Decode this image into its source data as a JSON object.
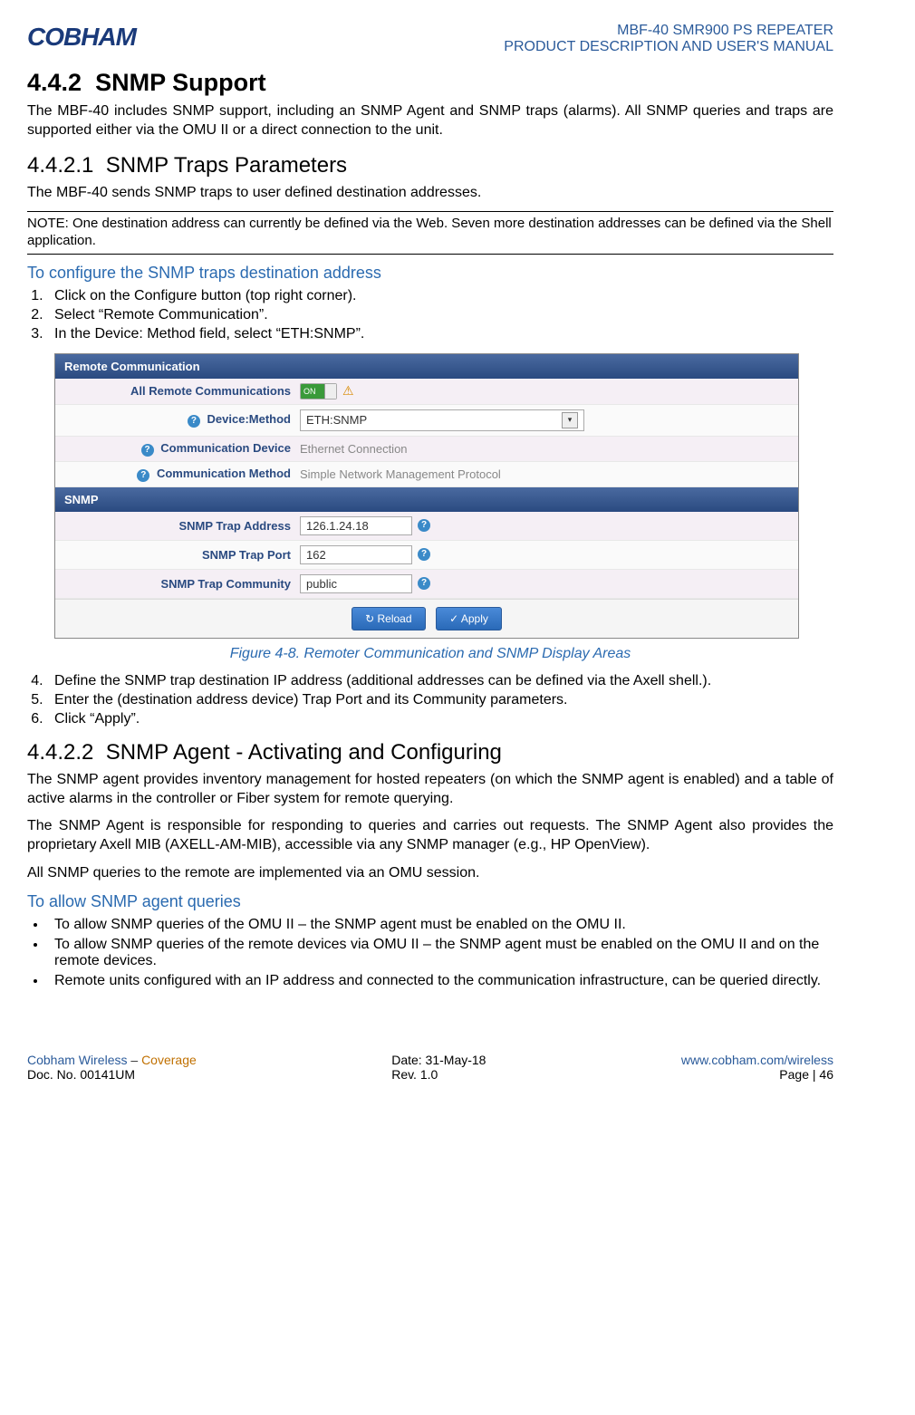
{
  "header": {
    "logo_text": "COBHAM",
    "title_line1": "MBF-40 SMR900 PS REPEATER",
    "title_line2": "PRODUCT DESCRIPTION AND USER'S MANUAL"
  },
  "s442": {
    "number": "4.4.2",
    "title": "SNMP Support",
    "para": "The MBF-40 includes SNMP support, including an SNMP Agent and SNMP traps (alarms). All SNMP queries and traps are supported either via the OMU II or a direct connection to the unit."
  },
  "s4421": {
    "number": "4.4.2.1",
    "title": "SNMP Traps Parameters",
    "para": "The MBF-40 sends SNMP traps to user defined destination addresses.",
    "note": "NOTE: One destination address can currently be defined via the Web. Seven more destination addresses can be defined via the Shell application.",
    "blue_sub": "To configure the SNMP traps destination address",
    "steps_a": [
      "Click on the Configure button (top right corner).",
      "Select “Remote Communication”.",
      "In the Device: Method field, select “ETH:SNMP”."
    ],
    "figure_caption": "Figure 4-8. Remoter Communication and SNMP Display Areas",
    "steps_b": [
      "Define the SNMP trap destination IP address (additional addresses can be defined via the Axell shell.).",
      "Enter the (destination address device) Trap Port and its Community parameters.",
      "Click “Apply”."
    ]
  },
  "screenshot": {
    "panel1_title": "Remote Communication",
    "rows1": [
      {
        "label": "All Remote Communications",
        "type": "toggle",
        "value": "ON"
      },
      {
        "label": "Device:Method",
        "type": "select",
        "value": "ETH:SNMP",
        "help": true
      },
      {
        "label": "Communication Device",
        "type": "text_ro",
        "value": "Ethernet Connection",
        "help": true
      },
      {
        "label": "Communication Method",
        "type": "text_ro",
        "value": "Simple Network Management Protocol",
        "help": true
      }
    ],
    "panel2_title": "SNMP",
    "rows2": [
      {
        "label": "SNMP Trap Address",
        "type": "input",
        "value": "126.1.24.18"
      },
      {
        "label": "SNMP Trap Port",
        "type": "input",
        "value": "162"
      },
      {
        "label": "SNMP Trap Community",
        "type": "input",
        "value": "public"
      }
    ],
    "btn_reload": "Reload",
    "btn_apply": "Apply"
  },
  "s4422": {
    "number": "4.4.2.2",
    "title": "SNMP Agent - Activating and Configuring",
    "para1": "The SNMP agent provides inventory management for hosted repeaters (on which the SNMP agent is enabled) and a table of active alarms in the controller or Fiber system for remote querying.",
    "para2": "The SNMP Agent is responsible for responding to queries and carries out requests. The SNMP Agent also provides the proprietary Axell MIB (AXELL-AM-MIB), accessible via any SNMP manager (e.g., HP OpenView).",
    "para3": "All SNMP queries to the remote are implemented via an OMU session.",
    "blue_sub": "To allow SNMP agent queries",
    "bullets": [
      "To allow SNMP queries of the OMU II – the SNMP agent must be enabled on the OMU II.",
      "To allow SNMP queries of the remote devices via OMU II – the SNMP agent must be enabled on the OMU II and on the remote devices.",
      "Remote units configured with an IP address and connected to the communication infrastructure, can be queried directly."
    ]
  },
  "footer": {
    "col1_l1_a": "Cobham Wireless",
    "col1_l1_dash": " – ",
    "col1_l1_b": "Coverage",
    "col1_l2": "Doc. No. 00141UM",
    "col2_l1": "Date: 31-May-18",
    "col2_l2": "Rev. 1.0",
    "col3_l1": "www.cobham.com/wireless",
    "col3_l2": "Page | 46"
  }
}
